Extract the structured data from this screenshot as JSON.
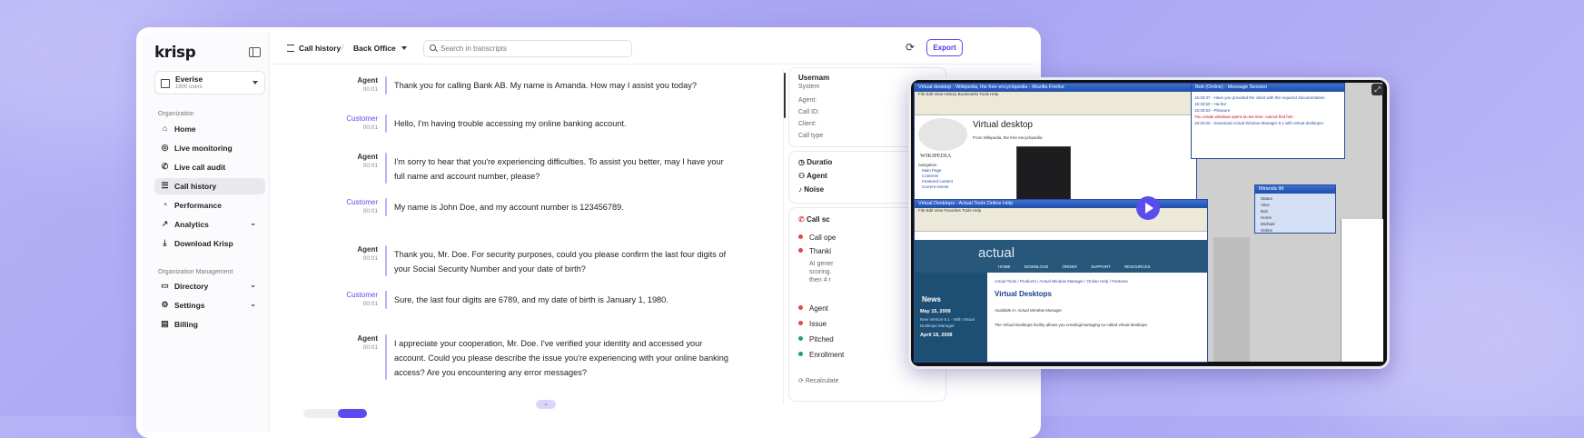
{
  "brand": {
    "logo": "krisp"
  },
  "workspace": {
    "name": "Everise",
    "users": "1800 users"
  },
  "sidebar": {
    "org_label": "Organization",
    "items": [
      {
        "label": "Home",
        "icon": "home-icon"
      },
      {
        "label": "Live monitoring",
        "icon": "monitor-icon"
      },
      {
        "label": "Live call audit",
        "icon": "phone-icon"
      },
      {
        "label": "Call history",
        "icon": "list-icon"
      },
      {
        "label": "Performance",
        "icon": "gauge-icon"
      },
      {
        "label": "Analytics",
        "icon": "chart-icon"
      },
      {
        "label": "Download Krisp",
        "icon": "download-icon"
      }
    ],
    "mgmt_label": "Organization Management",
    "mgmt_items": [
      {
        "label": "Directory",
        "icon": "folder-icon"
      },
      {
        "label": "Settings",
        "icon": "gear-icon"
      },
      {
        "label": "Billing",
        "icon": "card-icon"
      }
    ]
  },
  "topbar": {
    "crumb1": "Call history",
    "crumb2": "Back Office",
    "search_placeholder": "Search in transcripts",
    "export": "Export"
  },
  "transcript": [
    {
      "speaker": "Agent",
      "time": "00:01",
      "text": "Thank you for calling Bank AB. My name is Amanda. How may I assist you today?"
    },
    {
      "speaker": "Customer",
      "time": "00:01",
      "text": "Hello, I'm having trouble accessing my online banking account."
    },
    {
      "speaker": "Agent",
      "time": "00:01",
      "text": "I'm sorry to hear that you're experiencing difficulties. To assist you better, may I have your full name and account number, please?"
    },
    {
      "speaker": "Customer",
      "time": "00:01",
      "text": "My name is John Doe, and my account number is 123456789."
    },
    {
      "speaker": "Agent",
      "time": "00:01",
      "text": "Thank you, Mr. Doe. For security purposes, could you please confirm the last four digits of your Social Security Number and your date of birth?"
    },
    {
      "speaker": "Customer",
      "time": "00:01",
      "text": "Sure, the last four digits are 6789, and my date of birth is January 1, 1980."
    },
    {
      "speaker": "Agent",
      "time": "00:01",
      "text": "I appreciate your cooperation, Mr. Doe. I've verified your identity and accessed your account. Could you please describe the issue you're experiencing with your online banking access? Are you encountering any error messages?"
    }
  ],
  "details": {
    "user": "Usernam",
    "system": "System",
    "fields": [
      "Agent:",
      "Call ID:",
      "Client:",
      "Call type"
    ],
    "duration": "Duratio",
    "agent": "Agent",
    "noise": "Noise"
  },
  "score": {
    "title": "Call sc",
    "items": [
      {
        "label": "Call ope",
        "color": "#e5484d"
      },
      {
        "label": "Thanki",
        "color": "#e5484d"
      }
    ],
    "note": [
      "AI gener",
      "scoring.",
      "then 4 r"
    ],
    "items2": [
      {
        "label": "Agent",
        "color": "#e5484d"
      },
      {
        "label": "Issue",
        "color": "#e5484d"
      },
      {
        "label": "Pitched",
        "color": "#22a06b"
      },
      {
        "label": "Enrollment",
        "color": "#22a06b"
      }
    ],
    "recalc": "Recalculate"
  },
  "overlay": {
    "wiki_title": "Virtual desktop - Wikipedia, the free encyclopedia - Mozilla Firefox",
    "wiki_heading": "Virtual desktop",
    "wiki_sub": "From Wikipedia, the free encyclopedia",
    "wiki_logo": "WIKIPEDIA",
    "wiki_nav": [
      "navigation",
      "Main Page",
      "Contents",
      "Featured content",
      "Current events"
    ],
    "actual_title": "Virtual Desktops - Actual Tools Online Help",
    "actual_brand": "actual",
    "actual_menu": [
      "HOME",
      "DOWNLOAD",
      "ORDER",
      "SUPPORT",
      "RESOURCES"
    ],
    "actual_crumb": "Actual Tools / Products / Actual Window Manager / Online Help / Features",
    "actual_heading": "Virtual Desktops",
    "actual_avail": "Available in: Actual Window Manager",
    "actual_body": "The Virtual Desktops facility allows you creating/managing so-called virtual desktops.",
    "news": "News",
    "news_date": "May 15, 2008",
    "news_text": "New Version 6.1 - With Virtual Desktops Manager",
    "news_date2": "April 18, 2008",
    "msg_title": "Bob (Online) - Message Session",
    "chat": [
      "15:33:37 - Have you provided the client with the required documentation",
      "15:33:50 - Ha-ha!",
      "15:33:53 - Pleasure",
      "You create windows spent at one time. cannot find him",
      "15:34:00 - Download Actual Window Manager 5.1 with virtual desktops!"
    ],
    "misc_title": "Miranda IM",
    "misc_items": [
      "Status",
      "Alice",
      "Bob",
      "Home",
      "Michael",
      "Online"
    ]
  }
}
